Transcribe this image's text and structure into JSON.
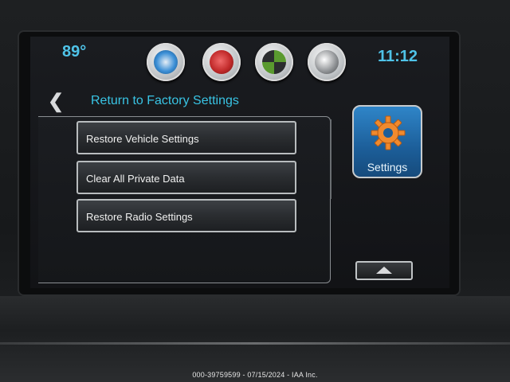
{
  "status_bar": {
    "temperature": "89°",
    "time": "11:12"
  },
  "app_icons": [
    {
      "name": "audio-icon",
      "color": "#3b8fd6"
    },
    {
      "name": "phone-icon",
      "color": "#c22b2b"
    },
    {
      "name": "navigation-icon",
      "color": "#5a9a2f"
    },
    {
      "name": "connect-icon",
      "color": "#8c8f92"
    }
  ],
  "header": {
    "back_icon": "chevron-left-icon",
    "title": "Return to Factory Settings"
  },
  "menu": {
    "items": [
      {
        "label": "Restore Vehicle Settings"
      },
      {
        "label": "Clear All Private Data"
      },
      {
        "label": "Restore Radio Settings"
      }
    ]
  },
  "settings_tile": {
    "label": "Settings",
    "icon": "gear-icon"
  },
  "up_button": {
    "icon": "chevron-up-icon"
  },
  "watermark": "000-39759599 - 07/15/2024 - IAA Inc."
}
